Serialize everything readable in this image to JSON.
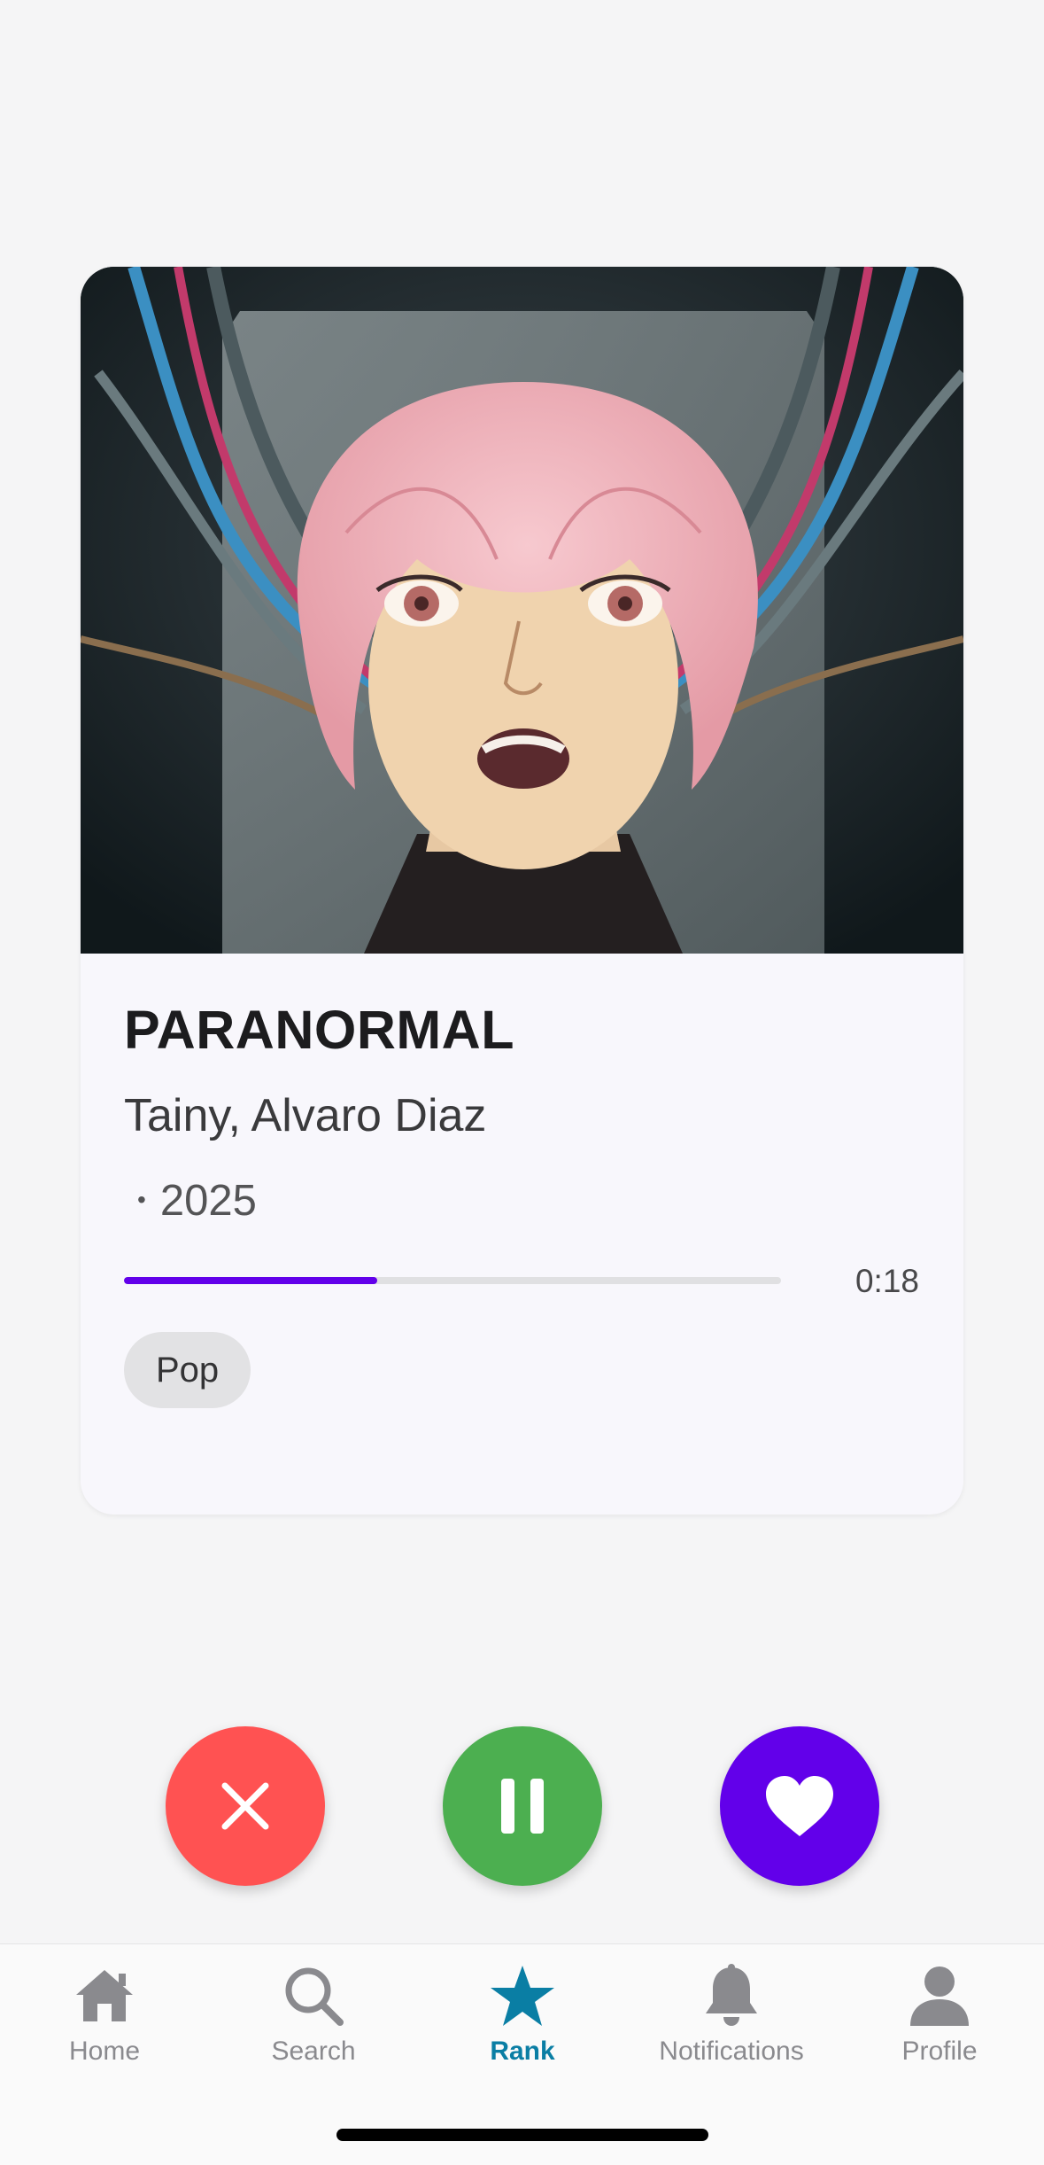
{
  "track": {
    "title": "PARANORMAL",
    "artists": "Tainy, Alvaro Diaz",
    "year": "2025",
    "separator": "•",
    "elapsed": "0:18",
    "progress_fraction": 0.385,
    "genre": "Pop",
    "artwork_icon": "album-cover-anime-character"
  },
  "actions": {
    "dislike_icon": "close-icon",
    "pause_icon": "pause-icon",
    "like_icon": "heart-icon"
  },
  "tabs": [
    {
      "label": "Home",
      "icon": "home-icon",
      "active": false
    },
    {
      "label": "Search",
      "icon": "search-icon",
      "active": false
    },
    {
      "label": "Rank",
      "icon": "star-icon",
      "active": true
    },
    {
      "label": "Notifications",
      "icon": "bell-icon",
      "active": false
    },
    {
      "label": "Profile",
      "icon": "person-icon",
      "active": false
    }
  ],
  "colors": {
    "accent": "#6200ea",
    "dislike": "#ff5252",
    "pause": "#4caf50",
    "active_tab": "#0a7ea4",
    "inactive_tab": "#8a8a8e"
  }
}
